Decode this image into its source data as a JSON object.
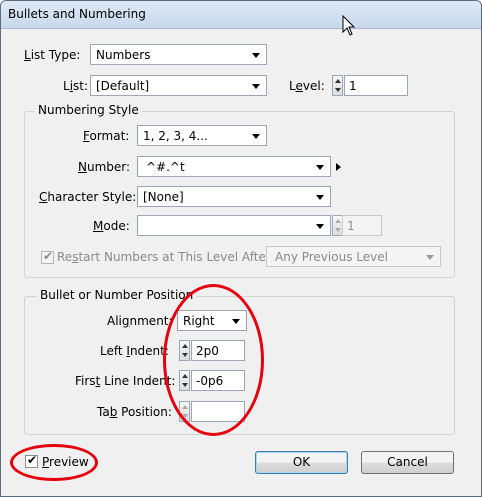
{
  "window": {
    "title": "Bullets and Numbering"
  },
  "top": {
    "list_type_label_u": "L",
    "list_type_label_rest": "ist Type:",
    "list_type_value": "Numbers",
    "list_label_pre": "L",
    "list_label_u": "i",
    "list_label_rest": "st:",
    "list_value": "[Default]",
    "level_label_pre": "L",
    "level_label_u": "e",
    "level_label_rest": "vel:",
    "level_value": "1"
  },
  "numbering_style": {
    "title": "Numbering Style",
    "format_label_u": "F",
    "format_label_rest": "ormat:",
    "format_value": "1, 2, 3, 4...",
    "number_label_u": "N",
    "number_label_rest": "umber:",
    "number_value": "^#.^t",
    "char_style_label_u": "C",
    "char_style_label_rest": "haracter Style:",
    "char_style_value": "[None]",
    "mode_label_u": "M",
    "mode_label_rest": "ode:",
    "mode_value": "",
    "mode_number": "1",
    "restart_label_pre": "Re",
    "restart_label_u": "s",
    "restart_label_rest": "tart Numbers at This Level After:",
    "restart_value": "Any Previous Level"
  },
  "position": {
    "title": "Bullet or Number Position",
    "alignment_label_pre": "Ali",
    "alignment_label_u": "g",
    "alignment_label_rest": "nment:",
    "alignment_value": "Right",
    "left_indent_label_pre": "Left ",
    "left_indent_label_u": "I",
    "left_indent_label_rest": "ndent:",
    "left_indent_value": "2p0",
    "first_line_label_pre": "Firs",
    "first_line_label_u": "t",
    "first_line_label_rest": " Line Indent:",
    "first_line_value": "-0p6",
    "tab_label_pre": "Ta",
    "tab_label_u": "b",
    "tab_label_rest": " Position:",
    "tab_value": ""
  },
  "footer": {
    "preview_label_u": "P",
    "preview_label_rest": "review",
    "preview_checked": true,
    "ok_label": "OK",
    "cancel_label": "Cancel"
  },
  "colors": {
    "annotation": "#e3000f",
    "title_bar": "#c8d8ec"
  },
  "icons": [
    "mouse-cursor-icon",
    "dropdown-arrow-icon",
    "spinner-icon",
    "submenu-arrow-icon",
    "checkmark-icon"
  ]
}
